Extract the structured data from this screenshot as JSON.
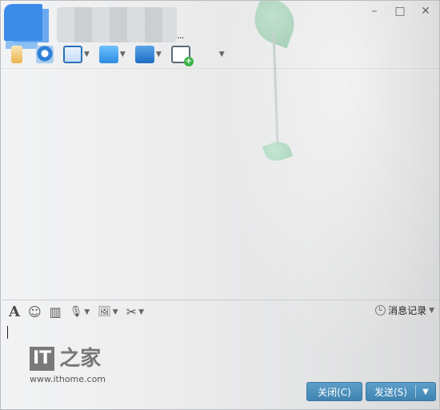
{
  "window": {
    "contact_name_suffix": "...",
    "controls": {
      "minimize": "–",
      "maximize": "□",
      "close": "✕"
    }
  },
  "toolbar": {
    "icons": [
      "voice-call-icon",
      "video-call-icon",
      "screen-share-icon",
      "file-transfer-icon",
      "remote-assist-icon",
      "create-group-icon",
      "apps-icon"
    ]
  },
  "input_toolbar": {
    "font_glyph": "A",
    "emoji_glyph": "☺",
    "shake_glyph": "▥",
    "voice_glyph": "🎙",
    "image_glyph": "🖼",
    "screenshot_glyph": "✂",
    "history_label": "消息记录"
  },
  "watermark": {
    "logo_it": "IT",
    "logo_zh": "之家",
    "url": "www.ithome.com"
  },
  "buttons": {
    "close_label": "关闭(C)",
    "send_label": "发送(S)"
  },
  "colors": {
    "button_blue": "#4a8fbd",
    "avatar_blue": "#3b8be8",
    "leaf_green": "#a2d4b8"
  }
}
